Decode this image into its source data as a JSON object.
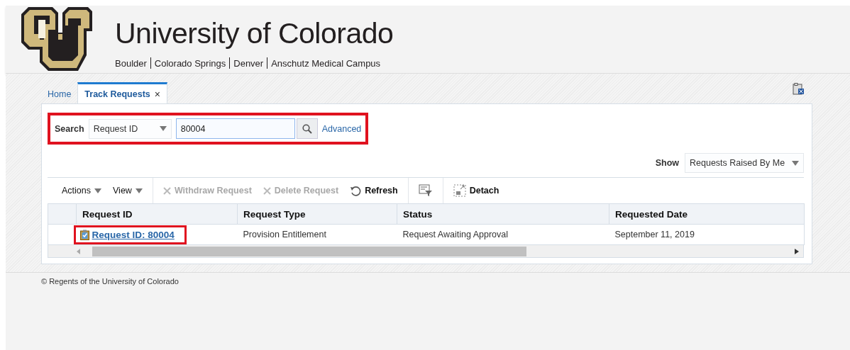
{
  "header": {
    "title": "University of Colorado",
    "campuses": [
      "Boulder",
      "Colorado Springs",
      "Denver",
      "Anschutz Medical Campus"
    ]
  },
  "tabs": [
    {
      "label": "Home",
      "selected": false
    },
    {
      "label": "Track Requests",
      "selected": true,
      "close": "×"
    }
  ],
  "search": {
    "label": "Search",
    "highlighted": true,
    "field_type": "Request ID",
    "value": "80004",
    "advanced": "Advanced"
  },
  "show": {
    "label": "Show",
    "value": "Requests Raised By Me"
  },
  "toolbar": [
    {
      "kind": "menu",
      "label": "Actions",
      "disabled": false
    },
    {
      "kind": "menu",
      "label": "View",
      "disabled": false
    },
    {
      "kind": "separator"
    },
    {
      "kind": "remove",
      "label": "Withdraw Request",
      "disabled": true
    },
    {
      "kind": "remove",
      "label": "Delete Request",
      "disabled": true
    },
    {
      "kind": "refresh",
      "label": "Refresh",
      "disabled": false
    },
    {
      "kind": "separator"
    },
    {
      "kind": "filter"
    },
    {
      "kind": "separator"
    },
    {
      "kind": "detach",
      "label": "Detach",
      "disabled": false
    }
  ],
  "table": {
    "columns": [
      "Request ID",
      "Request Type",
      "Status",
      "Requested Date"
    ],
    "rows": [
      {
        "request_id": "Request ID: 80004",
        "highlighted": true,
        "request_type": "Provision Entitlement",
        "status": "Request Awaiting Approval",
        "requested_date": "September 11, 2019"
      }
    ]
  },
  "footer": "© Regents of the University of Colorado"
}
